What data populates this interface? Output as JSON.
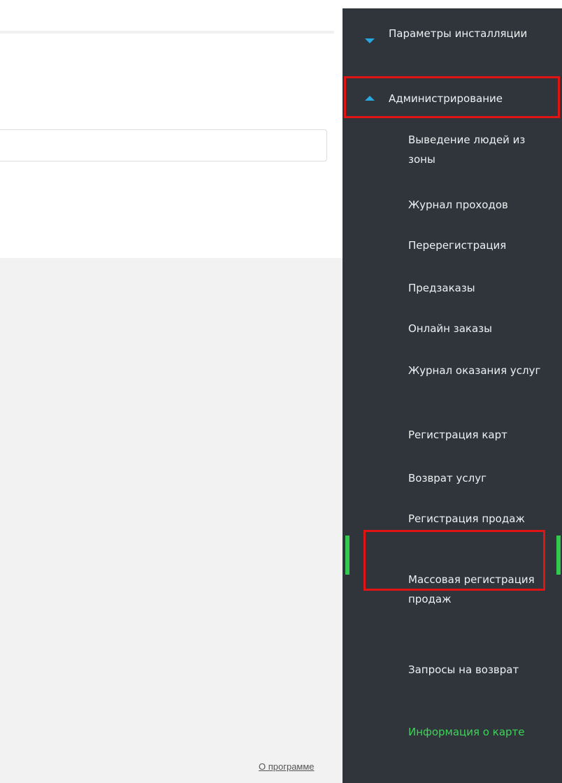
{
  "footer": {
    "about_link": "О программе"
  },
  "search": {
    "placeholder": ""
  },
  "sidebar": {
    "install_params": {
      "label": "Параметры инсталляции",
      "icon": "triangle-down-icon"
    },
    "administration": {
      "label": "Администрирование",
      "icon": "triangle-up-icon"
    },
    "sub_items": [
      "Выведение людей из зоны",
      "Журнал проходов",
      "Перерегистрация",
      "Предзаказы",
      "Онлайн заказы",
      "Журнал оказания услуг",
      "Регистрация карт",
      "Возврат услуг",
      "Регистрация продаж",
      "Массовая регистрация продаж",
      "Запросы на возврат",
      "Информация о карте"
    ],
    "active_item": "Информация о карте"
  },
  "colors": {
    "sidebar_bg": "#2f353a",
    "accent_blue": "#29a8e0",
    "active_green": "#3fd35a",
    "highlight_red": "#e01414",
    "content_bg": "#f2f2f2"
  }
}
